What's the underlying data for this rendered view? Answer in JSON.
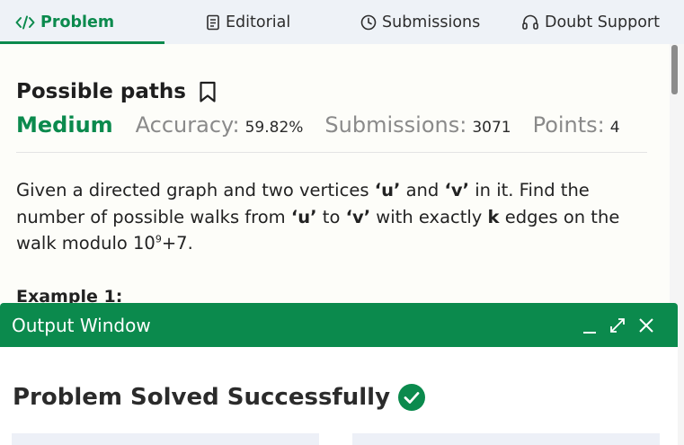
{
  "tabs": {
    "problem": "Problem",
    "editorial": "Editorial",
    "submissions": "Submissions",
    "doubt_support": "Doubt Support",
    "active": "problem"
  },
  "problem": {
    "title": "Possible paths",
    "difficulty": "Medium",
    "accuracy_label": "Accuracy:",
    "accuracy_value": "59.82%",
    "submissions_label": "Submissions:",
    "submissions_value": "3071",
    "points_label": "Points:",
    "points_value": "4",
    "description": {
      "t1": "Given a directed graph and two vertices ",
      "u1": "‘u’",
      "t2": " and ",
      "v1": "‘v’",
      "t3": " in it. Find the number of possible walks from ",
      "u2": "‘u’",
      "t4": " to ",
      "v2": "‘v’",
      "t5": " with exactly ",
      "k": "k",
      "t6": " edges on the walk modulo 10",
      "exp": "9",
      "t7": "+7."
    },
    "example_heading": "Example 1:"
  },
  "output": {
    "title": "Output Window",
    "status": "Problem Solved Successfully"
  },
  "colors": {
    "accent": "#0b8a4d",
    "tab_bar": "#eef2f7",
    "muted_text": "#8a8a8a"
  },
  "icons": {
    "problem": "code-icon",
    "editorial": "document-icon",
    "submissions": "clock-icon",
    "doubt_support": "headset-icon",
    "bookmark": "bookmark-icon",
    "minimize": "minimize-icon",
    "expand": "expand-icon",
    "close": "close-icon",
    "success": "check-circle-icon"
  }
}
